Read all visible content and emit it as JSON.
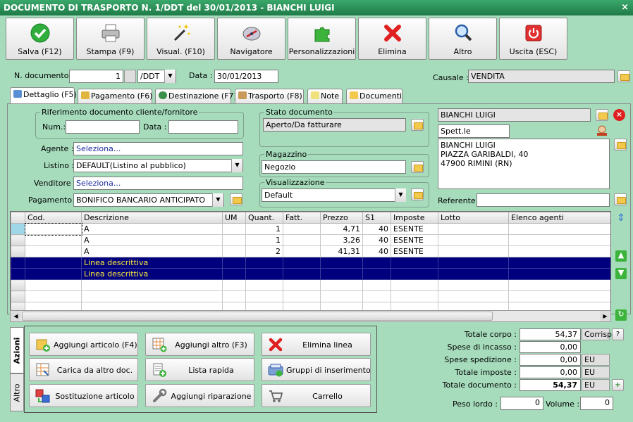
{
  "window": {
    "title": "DOCUMENTO DI TRASPORTO N. 1/DDT del 30/01/2013 - BIANCHI LUIGI",
    "close": "×"
  },
  "toolbar": {
    "save": "Salva (F12)",
    "print": "Stampa (F9)",
    "view": "Visual. (F10)",
    "navigator": "Navigatore",
    "custom": "Personalizzazioni",
    "delete": "Elimina",
    "other": "Altro",
    "exit": "Uscita (ESC)"
  },
  "header": {
    "doc_number_label": "N. documento :",
    "doc_number": "1",
    "doc_series": "/DDT",
    "date_label": "Data :",
    "date": "30/01/2013",
    "causal_label": "Causale :",
    "causal": "VENDITA"
  },
  "tabs": [
    "Dettaglio (F5)",
    "Pagamento (F6)",
    "Destinazione (F7)",
    "Trasporto (F8)",
    "Note",
    "Documenti"
  ],
  "reference": {
    "title": "Riferimento documento cliente/fornitore",
    "num_label": "Num.:",
    "num": "",
    "date_label": "Data :",
    "date": ""
  },
  "fields": {
    "agent_label": "Agente :",
    "agent": "Seleziona...",
    "listino_label": "Listino :",
    "listino": "DEFAULT(Listino al pubblico)",
    "seller_label": "Venditore :",
    "seller": "Seleziona...",
    "payment_label": "Pagamento :",
    "payment": "BONIFICO BANCARIO ANTICIPATO"
  },
  "status": {
    "title": "Stato documento",
    "value": "Aperto/Da fatturare"
  },
  "warehouse": {
    "title": "Magazzino",
    "value": "Negozio"
  },
  "display": {
    "title": "Visualizzazione",
    "value": "Default"
  },
  "customer": {
    "name": "BIANCHI LUIGI",
    "salutation": "Spett.le",
    "address": [
      "BIANCHI LUIGI",
      "PIAZZA GARIBALDI, 40",
      "47900 RIMINI (RN)"
    ],
    "referent_label": "Referente",
    "referent": ""
  },
  "grid": {
    "columns": [
      "Cod.",
      "Descrizione",
      "UM",
      "Quant.",
      "Fatt.",
      "Prezzo",
      "S1",
      "Imposte",
      "Lotto",
      "Elenco agenti"
    ],
    "rows": [
      {
        "cod": "",
        "desc": "A",
        "um": "",
        "qty": "1",
        "fatt": "",
        "price": "4,71",
        "s1": "40",
        "tax": "ESENTE",
        "lot": "",
        "agents": "",
        "sel": false
      },
      {
        "cod": "",
        "desc": "A",
        "um": "",
        "qty": "1",
        "fatt": "",
        "price": "3,26",
        "s1": "40",
        "tax": "ESENTE",
        "lot": "",
        "agents": "",
        "sel": false
      },
      {
        "cod": "",
        "desc": "A",
        "um": "",
        "qty": "2",
        "fatt": "",
        "price": "41,31",
        "s1": "40",
        "tax": "ESENTE",
        "lot": "",
        "agents": "",
        "sel": false
      },
      {
        "cod": "",
        "desc": "Linea descrittiva",
        "um": "",
        "qty": "",
        "fatt": "",
        "price": "",
        "s1": "",
        "tax": "",
        "lot": "",
        "agents": "",
        "sel": true
      },
      {
        "cod": "",
        "desc": "Linea descrittiva",
        "um": "",
        "qty": "",
        "fatt": "",
        "price": "",
        "s1": "",
        "tax": "",
        "lot": "",
        "agents": "",
        "sel": true
      },
      {
        "cod": "",
        "desc": "",
        "um": "",
        "qty": "",
        "fatt": "",
        "price": "",
        "s1": "",
        "tax": "",
        "lot": "",
        "agents": "",
        "sel": false
      }
    ]
  },
  "side_tabs": {
    "actions": "Azioni",
    "other": "Altro"
  },
  "actions": {
    "add_item": "Aggiungi articolo (F4)",
    "add_other": "Aggiungi altro (F3)",
    "delete_line": "Elimina linea",
    "load_doc": "Carica da altro doc.",
    "quick_list": "Lista rapida",
    "insert_groups": "Gruppi di inserimento",
    "replace_item": "Sostituzione articolo",
    "add_repair": "Aggiungi riparazione",
    "cart": "Carrello"
  },
  "totals": {
    "body_label": "Totale corpo :",
    "body": "54,37",
    "corrisp": "Corrisp.",
    "help": "?",
    "collection_label": "Spese di incasso :",
    "collection": "0,00",
    "shipping_label": "Spese spedizione :",
    "shipping": "0,00",
    "shipping_unit": "EU",
    "tax_label": "Totale imposte :",
    "tax": "0,00",
    "tax_unit": "EU",
    "doc_label": "Totale documento :",
    "doc": "54,37",
    "doc_unit": "EU",
    "gross_label": "Peso lordo :",
    "gross": "0",
    "volume_label": "Volume :",
    "volume": "0"
  }
}
